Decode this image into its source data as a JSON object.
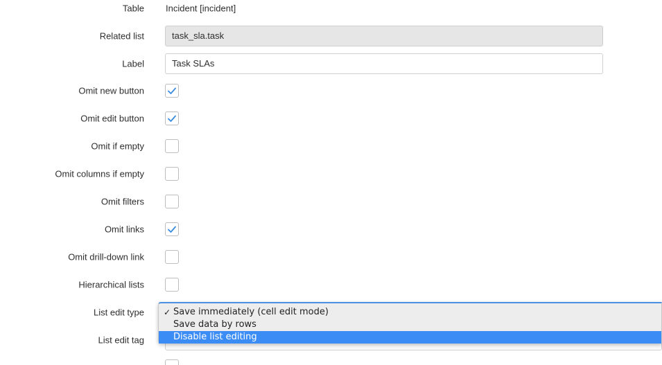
{
  "form": {
    "table": {
      "label": "Table",
      "value": "Incident [incident]"
    },
    "related_list": {
      "label": "Related list",
      "value": "task_sla.task"
    },
    "label_field": {
      "label": "Label",
      "value": "Task SLAs"
    },
    "checkboxes": [
      {
        "label": "Omit new button",
        "checked": true
      },
      {
        "label": "Omit edit button",
        "checked": true
      },
      {
        "label": "Omit if empty",
        "checked": false
      },
      {
        "label": "Omit columns if empty",
        "checked": false
      },
      {
        "label": "Omit filters",
        "checked": false
      },
      {
        "label": "Omit links",
        "checked": true
      },
      {
        "label": "Omit drill-down link",
        "checked": false
      },
      {
        "label": "Hierarchical lists",
        "checked": false
      }
    ],
    "list_edit_type": {
      "label": "List edit type",
      "options": [
        {
          "label": "Save immediately (cell edit mode)",
          "selected": true,
          "highlighted": false
        },
        {
          "label": "Save data by rows",
          "selected": false,
          "highlighted": false
        },
        {
          "label": "Disable list editing",
          "selected": false,
          "highlighted": true
        }
      ]
    },
    "list_edit_tag": {
      "label": "List edit tag"
    }
  },
  "colors": {
    "checkmark": "#3b8be0",
    "highlight": "#3b8df5",
    "readonly_bg": "#e6e6e6"
  }
}
